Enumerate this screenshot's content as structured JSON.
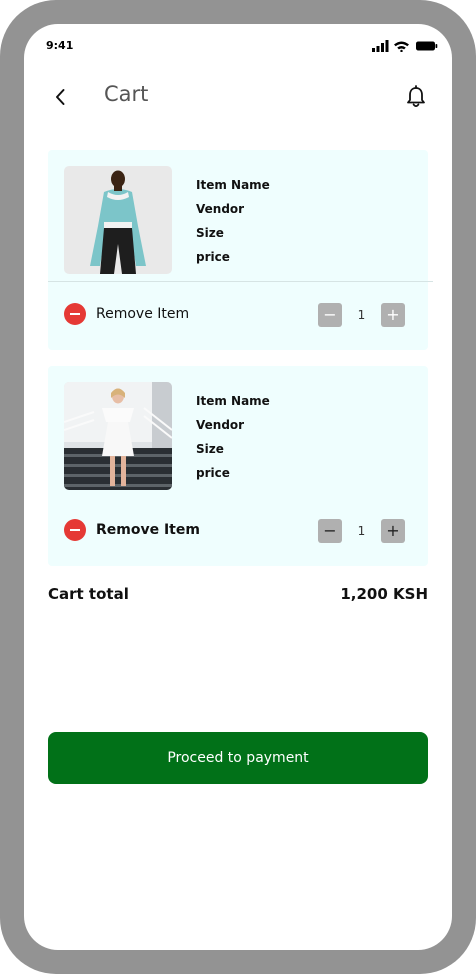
{
  "status_bar": {
    "time": "9:41"
  },
  "header": {
    "title": "Cart"
  },
  "cart_items": [
    {
      "name": "Item Name",
      "vendor": "Vendor",
      "size": "Size",
      "price": "price",
      "remove_label": "Remove Item",
      "quantity": "1",
      "minus_label": "−",
      "plus_label": "+"
    },
    {
      "name": "Item Name",
      "vendor": "Vendor",
      "size": "Size",
      "price": "price",
      "remove_label": "Remove Item",
      "quantity": "1",
      "minus_label": "−",
      "plus_label": "+"
    }
  ],
  "cart_total": {
    "label": "Cart total",
    "value": "1,200 KSH"
  },
  "actions": {
    "proceed_label": "Proceed to payment"
  },
  "colors": {
    "accent": "#017118",
    "remove": "#e53935",
    "card_background": "#effefe"
  },
  "icons": {
    "back": "chevron-left-icon",
    "notifications": "bell-icon",
    "remove": "minus-circle-icon"
  }
}
